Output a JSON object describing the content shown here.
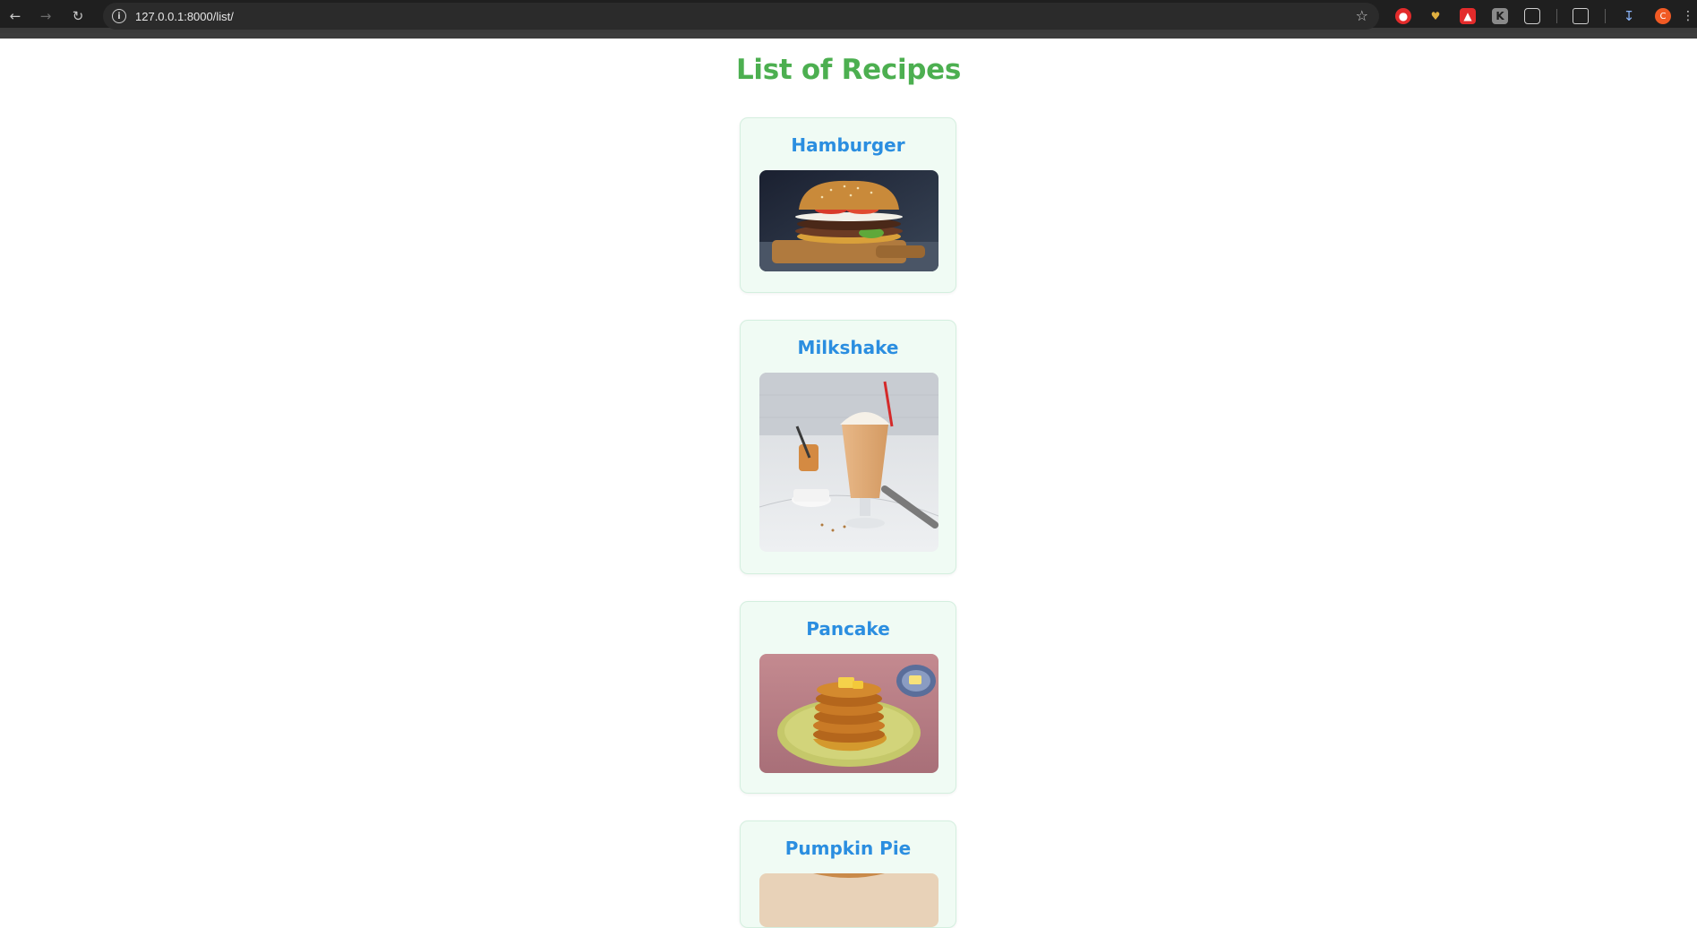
{
  "browser": {
    "url": "127.0.0.1:8000/list/",
    "profile_initial": "C"
  },
  "page": {
    "title": "List of Recipes"
  },
  "recipes": [
    {
      "name": "Hamburger"
    },
    {
      "name": "Milkshake"
    },
    {
      "name": "Pancake"
    },
    {
      "name": "Pumpkin Pie"
    }
  ],
  "colors": {
    "title_green": "#4caf50",
    "recipe_blue": "#2b8ee0",
    "card_bg": "#f0fbf4"
  }
}
